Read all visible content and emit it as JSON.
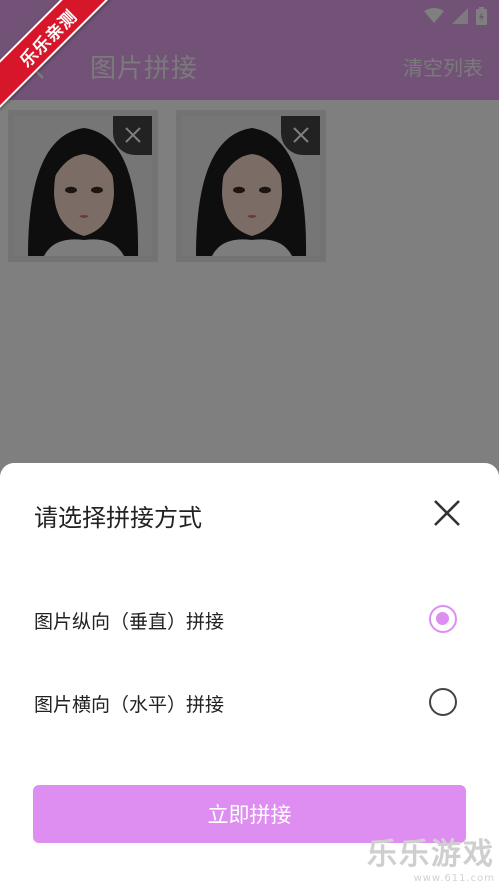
{
  "header": {
    "title": "图片拼接",
    "clear_label": "清空列表"
  },
  "watermark": {
    "ribbon_text": "乐乐亲测",
    "corner_title": "乐乐游戏",
    "corner_url": "www.611.com"
  },
  "images": [
    {
      "alt": "portrait-1"
    },
    {
      "alt": "portrait-2"
    }
  ],
  "sheet": {
    "title": "请选择拼接方式",
    "options": [
      {
        "label": "图片纵向（垂直）拼接",
        "selected": true
      },
      {
        "label": "图片横向（水平）拼接",
        "selected": false
      }
    ],
    "confirm_label": "立即拼接"
  },
  "colors": {
    "accent": "#de8ef0",
    "appbar": "#e4a6ee",
    "ribbon": "#d8162a"
  }
}
